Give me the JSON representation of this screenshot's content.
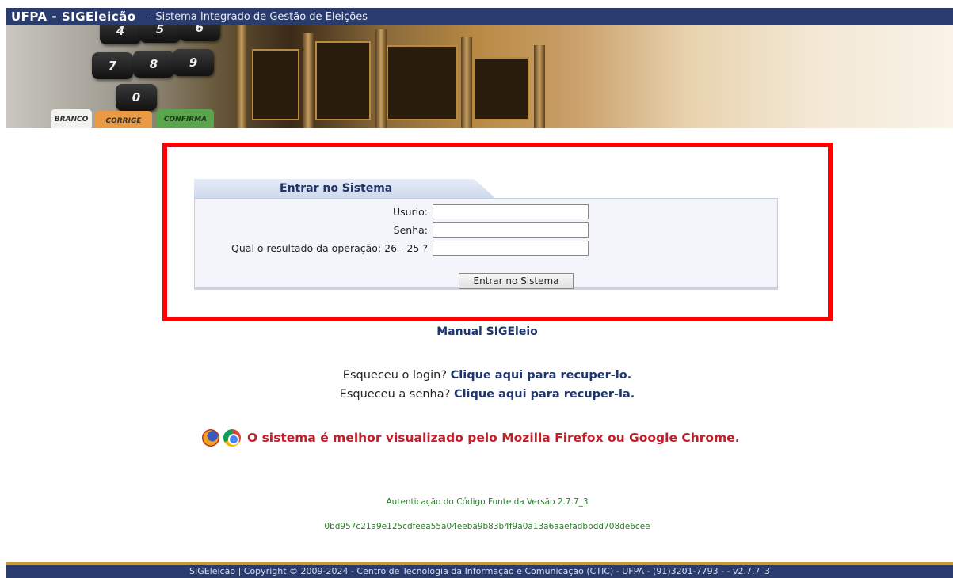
{
  "header": {
    "brand": "UFPA - SIGEleicão",
    "subtitle": "- Sistema Integrado de Gestão de Eleições"
  },
  "banner": {
    "keys": [
      "4",
      "5",
      "6",
      "7",
      "8",
      "9",
      "0"
    ],
    "buttons": [
      "BRANCO",
      "CORRIGE",
      "CONFIRMA"
    ]
  },
  "login": {
    "title": "Entrar no Sistema",
    "user_label": "Usurio:",
    "user_value": "",
    "password_label": "Senha:",
    "password_value": "",
    "captcha_label": "Qual o resultado da operação: 26 - 25 ?",
    "captcha_value": "",
    "submit_label": "Entrar no Sistema"
  },
  "links": {
    "manual": "Manual SIGEleio",
    "forgot_login_prefix": "Esqueceu o login?",
    "forgot_login_link": "Clique aqui para recuper-lo.",
    "forgot_password_prefix": "Esqueceu a senha?",
    "forgot_password_link": "Clique aqui para recuper-la."
  },
  "browser_notice": "O sistema é melhor visualizado pelo Mozilla Firefox ou Google Chrome.",
  "auth": {
    "label": "Autenticação do Código Fonte da Versão 2.7.7_3",
    "hash": "0bd957c21a9e125cdfeea55a04eeba9b83b4f9a0a13a6aaefadbbdd708de6cee"
  },
  "footer": "SIGEleicão | Copyright © 2009-2024 - Centro de Tecnologia da Informação e Comunicação (CTIC) - UFPA - (91)3201-7793 - - v2.7.7_3",
  "colors": {
    "header_bg": "#2a3c6e",
    "link": "#1f3770",
    "notice": "#c0202a",
    "auth": "#2a7a2a",
    "highlight_frame": "#ff0000"
  }
}
